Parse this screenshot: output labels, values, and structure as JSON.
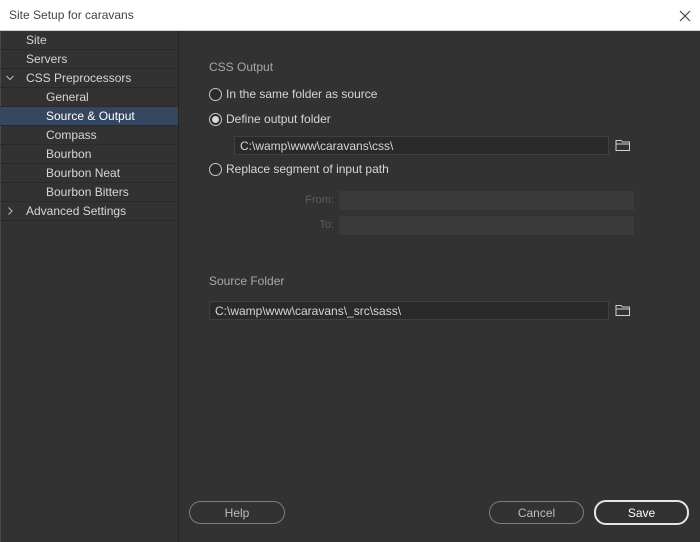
{
  "window": {
    "title": "Site Setup for caravans"
  },
  "sidebar": {
    "items": [
      {
        "label": "Site"
      },
      {
        "label": "Servers"
      },
      {
        "label": "CSS Preprocessors"
      },
      {
        "label": "General"
      },
      {
        "label": "Source & Output"
      },
      {
        "label": "Compass"
      },
      {
        "label": "Bourbon"
      },
      {
        "label": "Bourbon Neat"
      },
      {
        "label": "Bourbon Bitters"
      },
      {
        "label": "Advanced Settings"
      }
    ]
  },
  "css_output": {
    "heading": "CSS Output",
    "option_same_folder": "In the same folder as source",
    "option_define_folder": "Define output folder",
    "output_path": "C:\\wamp\\www\\caravans\\css\\",
    "option_replace_segment": "Replace segment of input path",
    "from_label": "From:",
    "to_label": "To:",
    "from_value": "",
    "to_value": "",
    "selected_option": "Define output folder"
  },
  "source_folder": {
    "heading": "Source Folder",
    "path": "C:\\wamp\\www\\caravans\\_src\\sass\\"
  },
  "buttons": {
    "help": "Help",
    "cancel": "Cancel",
    "save": "Save"
  }
}
